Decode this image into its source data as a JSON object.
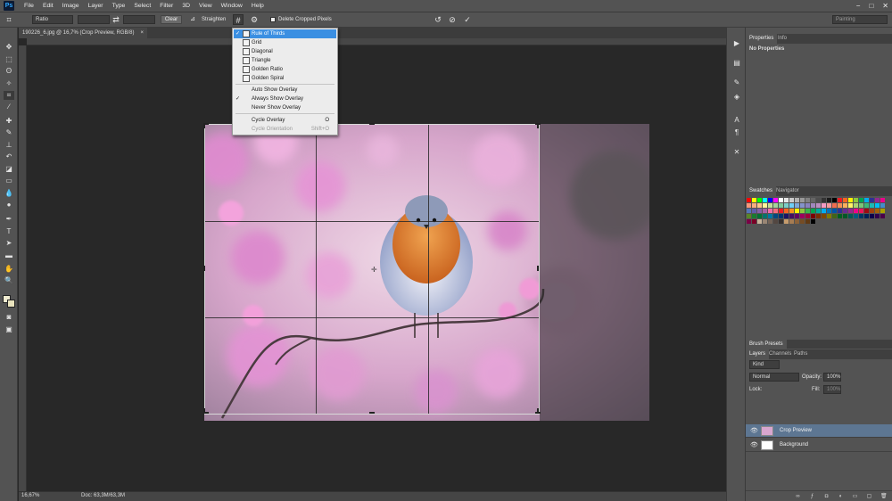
{
  "app": {
    "logo": "Ps"
  },
  "menu": [
    "File",
    "Edit",
    "Image",
    "Layer",
    "Type",
    "Select",
    "Filter",
    "3D",
    "View",
    "Window",
    "Help"
  ],
  "window_controls": {
    "minimize": "−",
    "maximize": "□",
    "close": "✕"
  },
  "options_bar": {
    "ratio_value": "Ratio",
    "clear_label": "Clear",
    "straighten_label": "Straighten",
    "delete_cropped_label": "Delete Cropped Pixels",
    "workspace_value": "Painting"
  },
  "document": {
    "tab_title": "190226_6.jpg @ 16,7% (Crop Preview, RGB/8)",
    "zoom": "16,67%",
    "doc_size": "Doc: 63,3M/63,3M"
  },
  "overlay_menu": {
    "items": [
      {
        "label": "Rule of Thirds",
        "checked": true,
        "highlighted": true
      },
      {
        "label": "Grid"
      },
      {
        "label": "Diagonal"
      },
      {
        "label": "Triangle"
      },
      {
        "label": "Golden Ratio"
      },
      {
        "label": "Golden Spiral"
      }
    ],
    "show_options": [
      {
        "label": "Auto Show Overlay",
        "checked": false
      },
      {
        "label": "Always Show Overlay",
        "checked": true
      },
      {
        "label": "Never Show Overlay",
        "checked": false
      }
    ],
    "cycle": [
      {
        "label": "Cycle Overlay",
        "shortcut": "O",
        "disabled": false
      },
      {
        "label": "Cycle Orientation",
        "shortcut": "Shift+O",
        "disabled": true
      }
    ]
  },
  "properties_panel": {
    "tabs": [
      "Properties",
      "Info"
    ],
    "body": "No Properties"
  },
  "swatches_panel": {
    "tabs": [
      "Swatches",
      "Navigator"
    ]
  },
  "brush_presets": {
    "title": "Brush Presets"
  },
  "layers_panel": {
    "tabs": [
      "Layers",
      "Channels",
      "Paths"
    ],
    "filter_label": "Kind",
    "blend_mode": "Normal",
    "opacity_label": "Opacity:",
    "opacity_value": "100%",
    "lock_label": "Lock:",
    "fill_label": "Fill:",
    "fill_value": "100%",
    "layers": [
      {
        "name": "Crop Preview",
        "selected": true
      },
      {
        "name": "Background",
        "selected": false
      }
    ]
  },
  "colors": {
    "accent": "#3b8fe2",
    "panel": "#535353",
    "canvas": "#282828"
  }
}
